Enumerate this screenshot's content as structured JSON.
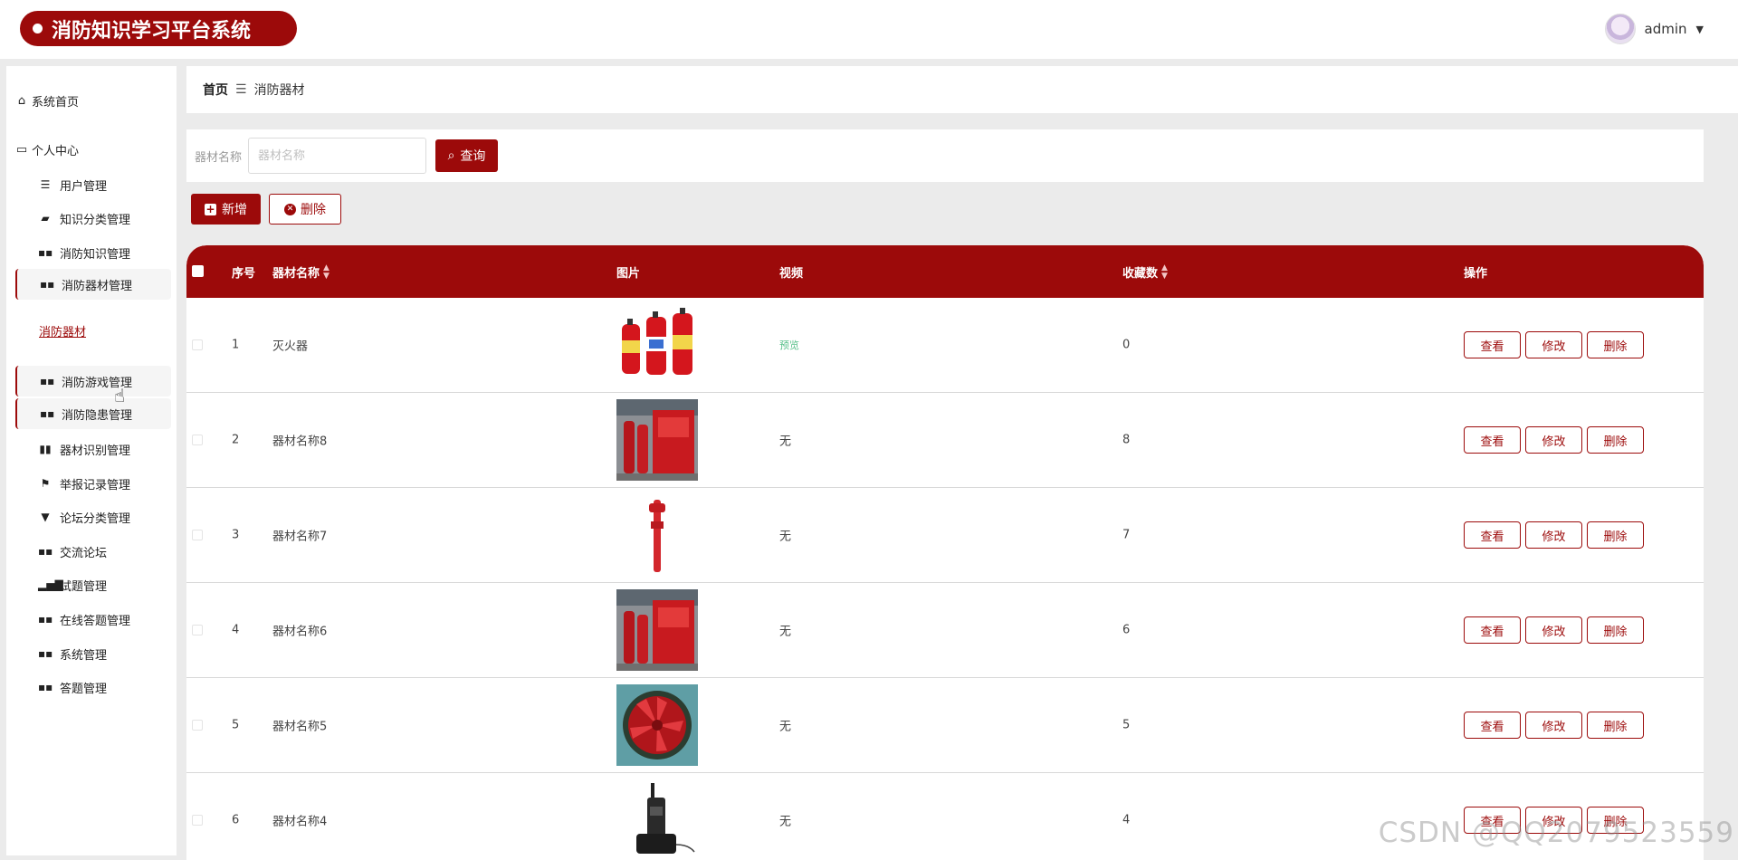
{
  "header": {
    "title": "消防知识学习平台系统",
    "user": "admin"
  },
  "sidebar": {
    "home": "系统首页",
    "personal": "个人中心",
    "items": [
      {
        "label": "用户管理",
        "icon": "list-icon"
      },
      {
        "label": "知识分类管理",
        "icon": "folder-icon"
      },
      {
        "label": "消防知识管理",
        "icon": "grid-icon"
      },
      {
        "label": "消防器材管理",
        "icon": "grid-icon"
      },
      {
        "label": "消防游戏管理",
        "icon": "grid-icon"
      },
      {
        "label": "消防隐患管理",
        "icon": "grid-icon"
      },
      {
        "label": "器材识别管理",
        "icon": "book-icon"
      },
      {
        "label": "举报记录管理",
        "icon": "flag-icon"
      },
      {
        "label": "论坛分类管理",
        "icon": "pin-icon"
      },
      {
        "label": "交流论坛",
        "icon": "grid-icon"
      },
      {
        "label": "试题管理",
        "icon": "chart-icon"
      },
      {
        "label": "在线答题管理",
        "icon": "grid-icon"
      },
      {
        "label": "系统管理",
        "icon": "grid-icon"
      },
      {
        "label": "答题管理",
        "icon": "grid-icon"
      }
    ],
    "sub_link": "消防器材"
  },
  "breadcrumb": {
    "home": "首页",
    "current": "消防器材"
  },
  "search": {
    "label": "器材名称",
    "placeholder": "器材名称",
    "button": "查询"
  },
  "toolbar": {
    "add": "新增",
    "delete": "删除"
  },
  "table": {
    "columns": {
      "index": "序号",
      "name": "器材名称",
      "image": "图片",
      "video": "视频",
      "fav": "收藏数",
      "ops": "操作"
    },
    "actions": {
      "view": "查看",
      "edit": "修改",
      "delete": "删除"
    },
    "rows": [
      {
        "index": "1",
        "name": "灭火器",
        "image": "fire-extinguishers-image",
        "video": "预览",
        "fav": "0"
      },
      {
        "index": "2",
        "name": "器材名称8",
        "image": "extinguisher-cabinet-image",
        "video": "无",
        "fav": "8"
      },
      {
        "index": "3",
        "name": "器材名称7",
        "image": "fire-pump-image",
        "video": "无",
        "fav": "7"
      },
      {
        "index": "4",
        "name": "器材名称6",
        "image": "extinguisher-cabinet-image",
        "video": "无",
        "fav": "6"
      },
      {
        "index": "5",
        "name": "器材名称5",
        "image": "smoke-exhaust-fan-image",
        "video": "无",
        "fav": "5"
      },
      {
        "index": "6",
        "name": "器材名称4",
        "image": "walkie-talkie-image",
        "video": "无",
        "fav": "4"
      }
    ]
  },
  "watermark": "CSDN @QQ2079523559",
  "colors": {
    "accent": "#9c0a0a",
    "preview": "#58c08a"
  }
}
